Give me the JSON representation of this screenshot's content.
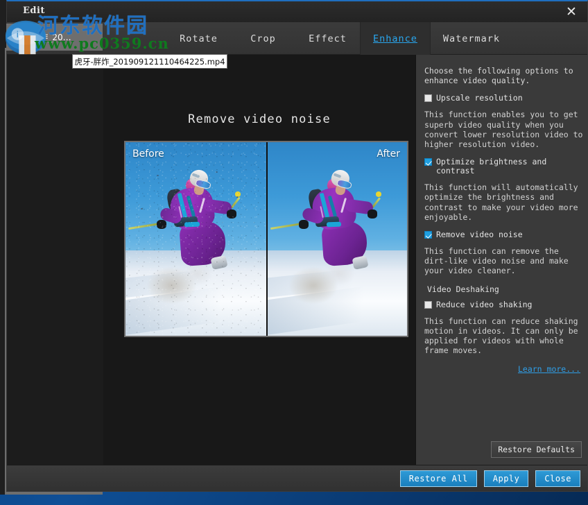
{
  "window": {
    "title": "Edit",
    "close_icon": "close-icon"
  },
  "file_tab": {
    "label": "虎牙-胖炸_20…",
    "tooltip": "虎牙-胖炸_201909121110464225.mp4"
  },
  "watermark": {
    "chinese": "河东软件园",
    "url": "www.pc0359.cn",
    "chinese_color": "#1f6fc0",
    "url_color": "#0f7a1e"
  },
  "tabs": [
    {
      "label": "Rotate",
      "active": false
    },
    {
      "label": "Crop",
      "active": false
    },
    {
      "label": "Effect",
      "active": false
    },
    {
      "label": "Enhance",
      "active": true
    },
    {
      "label": "Watermark",
      "active": false
    }
  ],
  "preview": {
    "title": "Remove video noise",
    "before_label": "Before",
    "after_label": "After"
  },
  "options_panel": {
    "intro": "Choose the following options to enhance video quality.",
    "items": [
      {
        "label": "Upscale resolution",
        "checked": false,
        "description": "This function enables you to get superb video quality when you convert lower resolution video to higher resolution video."
      },
      {
        "label": "Optimize brightness and contrast",
        "checked": true,
        "description": "This function will automatically optimize the brightness and contrast to make your video more enjoyable."
      },
      {
        "label": "Remove video noise",
        "checked": true,
        "description": "This function can remove the dirt-like video noise and make your video cleaner."
      }
    ],
    "deshaking_header": "Video Deshaking",
    "deshaking": {
      "label": "Reduce video shaking",
      "checked": false,
      "description": "This function can reduce shaking motion in videos. It can only be applied for videos with whole frame moves."
    },
    "learn_more": "Learn more...",
    "restore_defaults": "Restore Defaults"
  },
  "actions": {
    "restore_all": "Restore All",
    "apply": "Apply",
    "close": "Close",
    "accent_color": "#1f8ecb"
  }
}
